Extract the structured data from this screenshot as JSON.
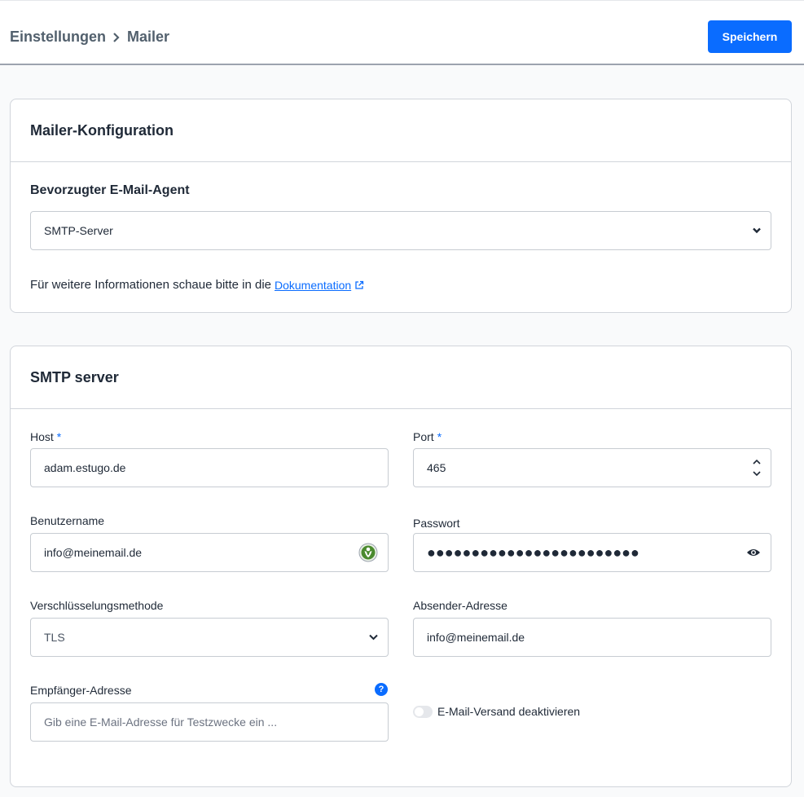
{
  "header": {
    "breadcrumb_root": "Einstellungen",
    "breadcrumb_current": "Mailer",
    "save_label": "Speichern"
  },
  "mailer_config": {
    "title": "Mailer-Konfiguration",
    "agent_label": "Bevorzugter E-Mail-Agent",
    "agent_value": "SMTP-Server",
    "info_text": "Für weitere Informationen schaue bitte in die",
    "doc_link": "Dokumentation"
  },
  "smtp": {
    "title": "SMTP server",
    "host_label": "Host",
    "host_value": "adam.estugo.de",
    "port_label": "Port",
    "port_value": "465",
    "username_label": "Benutzername",
    "username_value": "info@meinemail.de",
    "password_label": "Passwort",
    "password_dots": "●●●●●●●●●●●●●●●●●●●●●●●●",
    "encryption_label": "Verschlüsselungsmethode",
    "encryption_value": "TLS",
    "sender_label": "Absender-Adresse",
    "sender_value": "info@meinemail.de",
    "recipient_label": "Empfänger-Adresse",
    "recipient_placeholder": "Gib eine E-Mail-Adresse für Testzwecke ein ...",
    "disable_label": "E-Mail-Versand deaktivieren",
    "required_mark": "*",
    "help_mark": "?"
  },
  "colors": {
    "accent": "#0a6cff",
    "border": "#d1d5db",
    "background": "#f9fafb"
  }
}
